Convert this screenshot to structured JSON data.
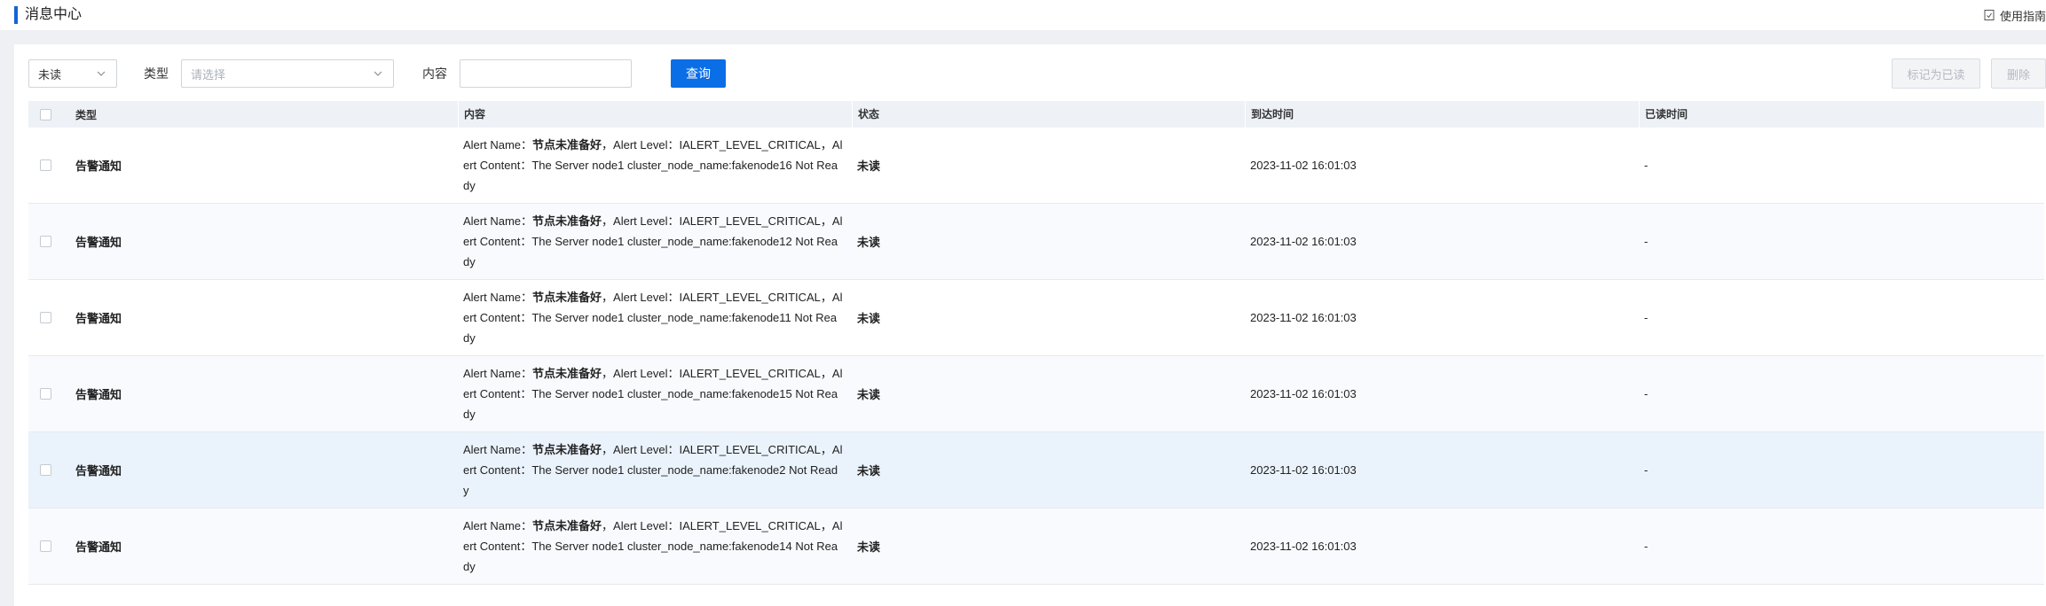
{
  "header": {
    "title": "消息中心",
    "guide_label": "使用指南"
  },
  "filters": {
    "read_status_value": "未读",
    "type_label": "类型",
    "type_placeholder": "请选择",
    "content_label": "内容",
    "content_value": "",
    "query_button": "查询",
    "mark_read_button": "标记为已读",
    "delete_button": "删除"
  },
  "table": {
    "columns": [
      "类型",
      "内容",
      "状态",
      "到达时间",
      "已读时间"
    ],
    "rows": [
      {
        "type": "告警通知",
        "content_prefix": "Alert Name：",
        "content_name": "节点未准备好",
        "content_rest": "，Alert Level：IALERT_LEVEL_CRITICAL，Alert Content：The Server node1 cluster_node_name:fakenode16 Not Ready",
        "status": "未读",
        "arrival": "2023-11-02 16:01:03",
        "read_time": "-"
      },
      {
        "type": "告警通知",
        "content_prefix": "Alert Name：",
        "content_name": "节点未准备好",
        "content_rest": "，Alert Level：IALERT_LEVEL_CRITICAL，Alert Content：The Server node1 cluster_node_name:fakenode12 Not Ready",
        "status": "未读",
        "arrival": "2023-11-02 16:01:03",
        "read_time": "-"
      },
      {
        "type": "告警通知",
        "content_prefix": "Alert Name：",
        "content_name": "节点未准备好",
        "content_rest": "，Alert Level：IALERT_LEVEL_CRITICAL，Alert Content：The Server node1 cluster_node_name:fakenode11 Not Ready",
        "status": "未读",
        "arrival": "2023-11-02 16:01:03",
        "read_time": "-"
      },
      {
        "type": "告警通知",
        "content_prefix": "Alert Name：",
        "content_name": "节点未准备好",
        "content_rest": "，Alert Level：IALERT_LEVEL_CRITICAL，Alert Content：The Server node1 cluster_node_name:fakenode15 Not Ready",
        "status": "未读",
        "arrival": "2023-11-02 16:01:03",
        "read_time": "-"
      },
      {
        "type": "告警通知",
        "content_prefix": "Alert Name：",
        "content_name": "节点未准备好",
        "content_rest": "，Alert Level：IALERT_LEVEL_CRITICAL，Alert Content：The Server node1 cluster_node_name:fakenode2 Not Ready",
        "status": "未读",
        "arrival": "2023-11-02 16:01:03",
        "read_time": "-"
      },
      {
        "type": "告警通知",
        "content_prefix": "Alert Name：",
        "content_name": "节点未准备好",
        "content_rest": "，Alert Level：IALERT_LEVEL_CRITICAL，Alert Content：The Server node1 cluster_node_name:fakenode14 Not Ready",
        "status": "未读",
        "arrival": "2023-11-02 16:01:03",
        "read_time": "-"
      }
    ]
  },
  "colors": {
    "accent": "#1463d6",
    "primary_button": "#0a6ee6",
    "header_row": "#eef2f7",
    "highlight_row": "#eaf3fc"
  },
  "icons": {
    "guide": "document-icon",
    "dropdown": "chevron-down-icon"
  }
}
